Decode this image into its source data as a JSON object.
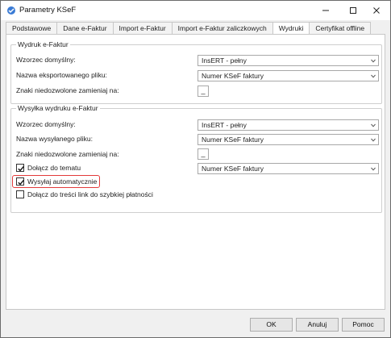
{
  "window": {
    "title": "Parametry KSeF"
  },
  "tabs": [
    {
      "label": "Podstawowe"
    },
    {
      "label": "Dane e-Faktur"
    },
    {
      "label": "Import e-Faktur"
    },
    {
      "label": "Import e-Faktur zaliczkowych"
    },
    {
      "label": "Wydruki"
    },
    {
      "label": "Certyfikat offline"
    }
  ],
  "active_tab": "Wydruki",
  "print_group": {
    "legend": "Wydruk e-Faktur",
    "default_template_label": "Wzorzec domyślny:",
    "default_template_value": "InsERT - pełny",
    "export_file_name_label": "Nazwa eksportowanego pliku:",
    "export_file_name_value": "Numer KSeF faktury",
    "replace_chars_label": "Znaki niedozwolone zamieniaj na:",
    "replace_chars_value": "_"
  },
  "send_group": {
    "legend": "Wysyłka wydruku e-Faktur",
    "default_template_label": "Wzorzec domyślny:",
    "default_template_value": "InsERT - pełny",
    "sent_file_name_label": "Nazwa wysyłanego pliku:",
    "sent_file_name_value": "Numer KSeF faktury",
    "replace_chars_label": "Znaki niedozwolone zamieniaj na:",
    "replace_chars_value": "_",
    "attach_to_subject_label": "Dołącz do tematu",
    "attach_to_subject_checked": true,
    "attach_to_subject_value": "Numer KSeF faktury",
    "send_automatically_label": "Wysyłaj automatycznie",
    "send_automatically_checked": true,
    "attach_link_label": "Dołącz do treści link do szybkiej płatności",
    "attach_link_checked": false
  },
  "buttons": {
    "ok": "OK",
    "cancel": "Anuluj",
    "help": "Pomoc"
  },
  "colors": {
    "highlight": "#e23b3b"
  }
}
